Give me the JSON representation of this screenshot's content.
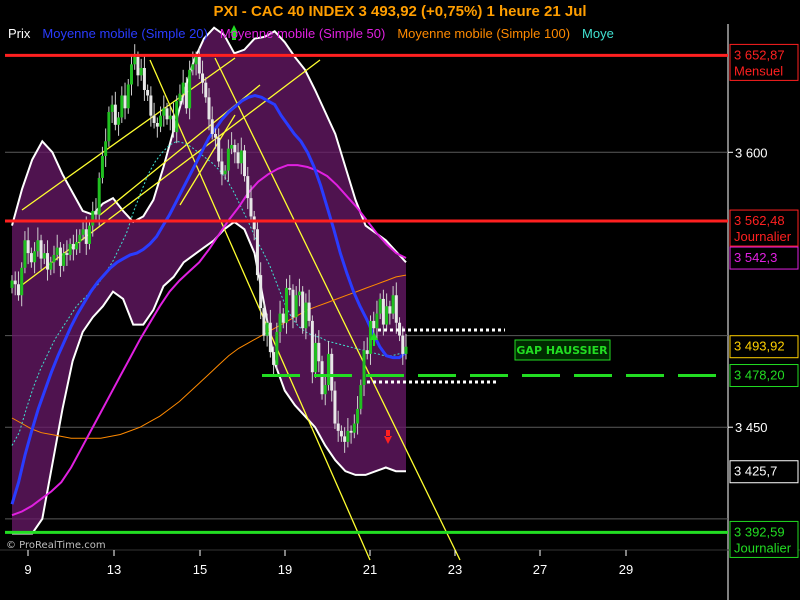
{
  "chart_data": {
    "type": "candlestick",
    "title": "PXI - CAC 40 INDEX     3 493,92 (+0,75%)     1 heure  21 Jul",
    "legend": [
      {
        "label": "Prix",
        "color": "#ffffff"
      },
      {
        "label": "Moyenne mobile (Simple 20)",
        "color": "#2a3cff"
      },
      {
        "label": "Moyenne mobile (Simple 50)",
        "color": "#e020e0"
      },
      {
        "label": "Moyenne mobile (Simple 100)",
        "color": "#ff8a00"
      },
      {
        "label": "Moye",
        "color": "#40e0d0"
      }
    ],
    "x_ticks": [
      "9",
      "13",
      "15",
      "19",
      "21",
      "23",
      "27",
      "29"
    ],
    "y_ticks": [
      {
        "label": "3 600",
        "value": 3600
      },
      {
        "label": "3 450",
        "value": 3450
      }
    ],
    "ylim": [
      3383,
      3670
    ],
    "price_tags": [
      {
        "label": "3 652,87",
        "sub": "Mensuel",
        "value": 3652.87,
        "color": "#ff2020"
      },
      {
        "label": "3 562,48",
        "sub": "Journalier",
        "value": 3562.48,
        "color": "#ff2020"
      },
      {
        "label": "3 542,3",
        "sub": "",
        "value": 3542.3,
        "color": "#e020e0"
      },
      {
        "label": "3 493,92",
        "sub": "",
        "value": 3493.92,
        "color": "#ffd000"
      },
      {
        "label": "3 478,20",
        "sub": "",
        "value": 3478.2,
        "color": "#22dd22"
      },
      {
        "label": "3 425,7",
        "sub": "",
        "value": 3425.7,
        "color": "#ffffff"
      },
      {
        "label": "3 392,59",
        "sub": "Journalier",
        "value": 3392.59,
        "color": "#22dd22"
      }
    ],
    "horizontal_lines": [
      {
        "value": 3652.87,
        "color": "#ff2020",
        "style": "solid"
      },
      {
        "value": 3562.48,
        "color": "#ff2020",
        "style": "solid"
      },
      {
        "value": 3392.59,
        "color": "#22dd22",
        "style": "solid"
      },
      {
        "value": 3478.2,
        "color": "#22dd22",
        "style": "dashed"
      }
    ],
    "annotation": "GAP HAUSSIER",
    "watermark": "© ProRealTime.com",
    "closes": [
      3530,
      3528,
      3522,
      3537,
      3552,
      3545,
      3540,
      3546,
      3552,
      3542,
      3545,
      3536,
      3540,
      3544,
      3548,
      3538,
      3545,
      3544,
      3550,
      3547,
      3551,
      3555,
      3558,
      3550,
      3560,
      3568,
      3566,
      3586,
      3598,
      3606,
      3622,
      3626,
      3615,
      3619,
      3631,
      3624,
      3637,
      3648,
      3652,
      3642,
      3646,
      3634,
      3631,
      3620,
      3616,
      3614,
      3620,
      3624,
      3618,
      3620,
      3611,
      3628,
      3632,
      3638,
      3624,
      3645,
      3648,
      3652,
      3643,
      3638,
      3630,
      3618,
      3610,
      3608,
      3595,
      3588,
      3590,
      3602,
      3604,
      3600,
      3594,
      3601,
      3587,
      3575,
      3565,
      3558,
      3533,
      3515,
      3500,
      3507,
      3491,
      3484,
      3502,
      3512,
      3507,
      3526,
      3525,
      3510,
      3522,
      3524,
      3504,
      3518,
      3508,
      3480,
      3496,
      3486,
      3468,
      3473,
      3490,
      3470,
      3452,
      3448,
      3445,
      3442,
      3448,
      3447,
      3452,
      3460,
      3473,
      3492,
      3490,
      3508,
      3504,
      3512,
      3520,
      3506,
      3516,
      3512,
      3522,
      3507,
      3500,
      3490,
      3493.92
    ],
    "sma20": [
      3408,
      3420,
      3435,
      3448,
      3460,
      3470,
      3480,
      3489,
      3497,
      3505,
      3512,
      3518,
      3524,
      3529,
      3533,
      3537,
      3540,
      3542,
      3544,
      3545,
      3547,
      3550,
      3554,
      3560,
      3566,
      3573,
      3580,
      3587,
      3594,
      3601,
      3608,
      3613,
      3618,
      3622,
      3625,
      3628,
      3630,
      3631,
      3630,
      3628,
      3626,
      3620,
      3615,
      3610,
      3606,
      3600,
      3592,
      3582,
      3570,
      3558,
      3545,
      3534,
      3524,
      3516,
      3509,
      3501,
      3494,
      3489,
      3488,
      3488,
      3491
    ],
    "sma50": [
      3402,
      3404,
      3407,
      3411,
      3415,
      3420,
      3428,
      3438,
      3448,
      3458,
      3468,
      3478,
      3488,
      3498,
      3507,
      3516,
      3524,
      3530,
      3535,
      3540,
      3547,
      3555,
      3563,
      3570,
      3578,
      3584,
      3588,
      3591,
      3593,
      3593,
      3592,
      3590,
      3587,
      3582,
      3576,
      3570,
      3563,
      3556,
      3550,
      3545,
      3542.3
    ],
    "sma100": [
      3455,
      3452,
      3449,
      3447,
      3446,
      3445,
      3444,
      3444,
      3444,
      3444,
      3445,
      3446,
      3448,
      3450,
      3453,
      3456,
      3460,
      3464,
      3469,
      3474,
      3479,
      3484,
      3489,
      3493,
      3496,
      3499,
      3502,
      3505,
      3508,
      3511,
      3514,
      3516,
      3518,
      3520,
      3522,
      3524,
      3526,
      3528,
      3530,
      3532,
      3533
    ],
    "sma_long": [
      3440,
      3447,
      3460,
      3472,
      3482,
      3490,
      3498,
      3504,
      3510,
      3516,
      3520,
      3524,
      3528,
      3534,
      3540,
      3548,
      3556,
      3568,
      3578,
      3588,
      3595,
      3600,
      3604,
      3606,
      3605,
      3603,
      3600,
      3597,
      3594,
      3590,
      3585,
      3578,
      3570,
      3562,
      3553,
      3546,
      3538,
      3528,
      3518,
      3510,
      3505,
      3502,
      3500,
      3499,
      3497,
      3496,
      3495,
      3494,
      3493,
      3492,
      3491,
      3490,
      3489,
      3489,
      3490,
      3491
    ],
    "bb_upper": [
      3560,
      3580,
      3596,
      3606,
      3600,
      3588,
      3578,
      3568,
      3566,
      3572,
      3575,
      3568,
      3562,
      3565,
      3574,
      3592,
      3612,
      3632,
      3650,
      3662,
      3668,
      3664,
      3654,
      3656,
      3662,
      3663,
      3666,
      3660,
      3652,
      3645,
      3634,
      3622,
      3610,
      3592,
      3574,
      3560,
      3556,
      3552,
      3546,
      3540
    ],
    "bb_lower": [
      3392,
      3392,
      3392,
      3400,
      3430,
      3460,
      3486,
      3502,
      3510,
      3516,
      3524,
      3520,
      3506,
      3506,
      3514,
      3527,
      3532,
      3540,
      3544,
      3548,
      3552,
      3558,
      3562,
      3558,
      3545,
      3516,
      3485,
      3470,
      3462,
      3456,
      3450,
      3440,
      3432,
      3426,
      3424,
      3424,
      3426,
      3428,
      3426,
      3426
    ]
  }
}
